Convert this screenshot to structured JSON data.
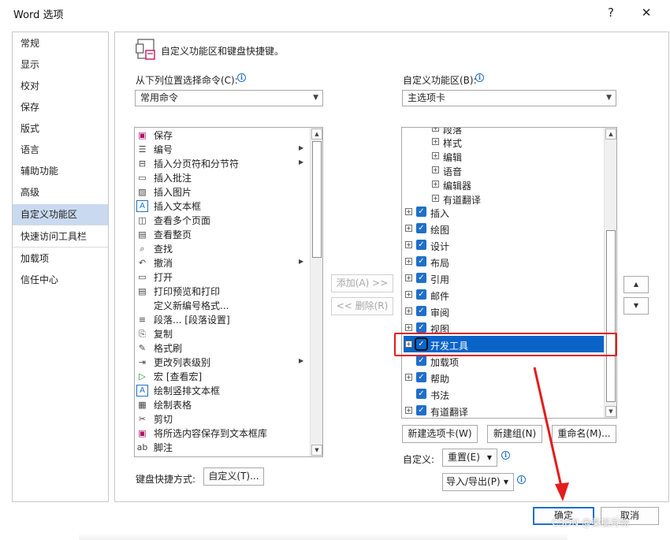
{
  "window": {
    "title": "Word 选项",
    "help": "?",
    "close": "✕"
  },
  "nav": {
    "items": [
      "常规",
      "显示",
      "校对",
      "保存",
      "版式",
      "语言",
      "辅助功能",
      "高级",
      "自定义功能区",
      "快速访问工具栏",
      "加载项",
      "信任中心"
    ],
    "selected_index": 8
  },
  "header": {
    "title": "自定义功能区和键盘快捷键。"
  },
  "left": {
    "label": "从下列位置选择命令(C):",
    "dropdown_value": "常用命令",
    "commands": [
      {
        "label": "保存",
        "icon": "save-icon",
        "glyph": "▣",
        "sub": false
      },
      {
        "label": "编号",
        "icon": "numbering-icon",
        "glyph": "☰",
        "sub": true
      },
      {
        "label": "插入分页符和分节符",
        "icon": "page-break-icon",
        "glyph": "⊟",
        "sub": true
      },
      {
        "label": "插入批注",
        "icon": "comment-icon",
        "glyph": "▭",
        "sub": false
      },
      {
        "label": "插入图片",
        "icon": "picture-icon",
        "glyph": "▨",
        "sub": false
      },
      {
        "label": "插入文本框",
        "icon": "textbox-icon",
        "glyph": "A",
        "sub": false
      },
      {
        "label": "查看多个页面",
        "icon": "multipage-icon",
        "glyph": "◫",
        "sub": false
      },
      {
        "label": "查看整页",
        "icon": "full-page-icon",
        "glyph": "▤",
        "sub": false
      },
      {
        "label": "查找",
        "icon": "find-icon",
        "glyph": "⌕",
        "sub": false
      },
      {
        "label": "撤消",
        "icon": "undo-icon",
        "glyph": "↶",
        "sub": true
      },
      {
        "label": "打开",
        "icon": "open-icon",
        "glyph": "▭",
        "sub": false
      },
      {
        "label": "打印预览和打印",
        "icon": "print-preview-icon",
        "glyph": "▤",
        "sub": false
      },
      {
        "label": "定义新编号格式...",
        "icon": "",
        "glyph": "",
        "sub": false
      },
      {
        "label": "段落... [段落设置]",
        "icon": "paragraph-icon",
        "glyph": "≡",
        "sub": false
      },
      {
        "label": "复制",
        "icon": "copy-icon",
        "glyph": "⎘",
        "sub": false
      },
      {
        "label": "格式刷",
        "icon": "format-painter-icon",
        "glyph": "✎",
        "sub": false
      },
      {
        "label": "更改列表级别",
        "icon": "list-level-icon",
        "glyph": "⇥",
        "sub": true
      },
      {
        "label": "宏 [查看宏]",
        "icon": "macro-icon",
        "glyph": "▷",
        "sub": false
      },
      {
        "label": "绘制竖排文本框",
        "icon": "vertical-textbox-icon",
        "glyph": "A",
        "sub": false
      },
      {
        "label": "绘制表格",
        "icon": "draw-table-icon",
        "glyph": "▦",
        "sub": false
      },
      {
        "label": "剪切",
        "icon": "cut-icon",
        "glyph": "✂",
        "sub": false
      },
      {
        "label": "将所选内容保存到文本框库",
        "icon": "save-selection-icon",
        "glyph": "▣",
        "sub": false
      },
      {
        "label": "脚注",
        "icon": "footnote-icon",
        "glyph": "ab",
        "sub": false
      }
    ]
  },
  "middle": {
    "add": "添加(A) >>",
    "remove": "<< 删除(R)"
  },
  "right": {
    "label": "自定义功能区(B):",
    "dropdown_value": "主选项卡",
    "tree": [
      {
        "label": "段落",
        "level": 2,
        "checked": false,
        "selected": false
      },
      {
        "label": "样式",
        "level": 2,
        "checked": false,
        "selected": false
      },
      {
        "label": "编辑",
        "level": 2,
        "checked": false,
        "selected": false
      },
      {
        "label": "语音",
        "level": 2,
        "checked": false,
        "selected": false
      },
      {
        "label": "编辑器",
        "level": 2,
        "checked": false,
        "selected": false
      },
      {
        "label": "有道翻译",
        "level": 2,
        "checked": false,
        "selected": false
      },
      {
        "label": "插入",
        "level": 1,
        "checked": true,
        "selected": false
      },
      {
        "label": "绘图",
        "level": 1,
        "checked": true,
        "selected": false
      },
      {
        "label": "设计",
        "level": 1,
        "checked": true,
        "selected": false
      },
      {
        "label": "布局",
        "level": 1,
        "checked": true,
        "selected": false
      },
      {
        "label": "引用",
        "level": 1,
        "checked": true,
        "selected": false
      },
      {
        "label": "邮件",
        "level": 1,
        "checked": true,
        "selected": false
      },
      {
        "label": "审阅",
        "level": 1,
        "checked": true,
        "selected": false
      },
      {
        "label": "视图",
        "level": 1,
        "checked": true,
        "selected": false
      },
      {
        "label": "开发工具",
        "level": 1,
        "checked": true,
        "selected": true
      },
      {
        "label": "加载项",
        "level": 1,
        "checked": true,
        "selected": false,
        "no_expander": true
      },
      {
        "label": "帮助",
        "level": 1,
        "checked": true,
        "selected": false
      },
      {
        "label": "书法",
        "level": 1,
        "checked": true,
        "selected": false,
        "no_expander": true
      },
      {
        "label": "有道翻译",
        "level": 1,
        "checked": true,
        "selected": false
      }
    ],
    "new_tab": "新建选项卡(W)",
    "new_group": "新建组(N)",
    "rename": "重命名(M)...",
    "customize_label": "自定义:",
    "reset": "重置(E)",
    "import_export": "导入/导出(P)"
  },
  "keyboard": {
    "label": "键盘快捷方式:",
    "button": "自定义(T)..."
  },
  "footer": {
    "ok": "确定",
    "cancel": "取消"
  },
  "watermark": "CSDN @桑榆肖物",
  "colors": {
    "accent": "#1f6fc9",
    "selection": "#0a64c8",
    "annotation": "#e21d1d",
    "nav_selected": "#c9daf0"
  }
}
